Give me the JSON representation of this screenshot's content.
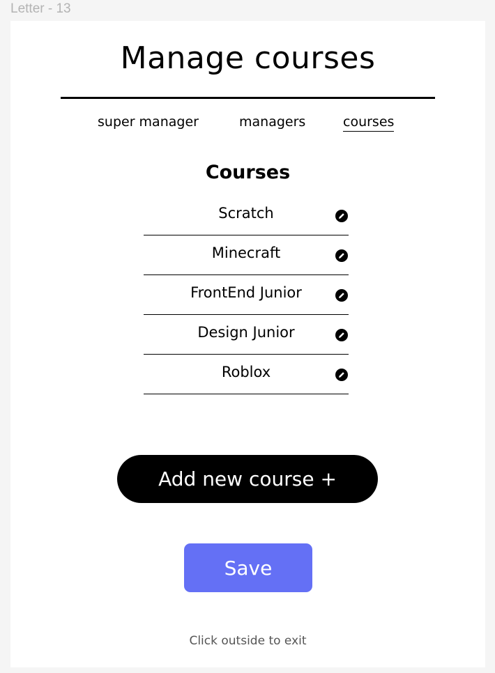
{
  "frame_label": "Letter - 13",
  "page_title": "Manage courses",
  "nav": {
    "items": [
      {
        "label": "super manager",
        "active": false
      },
      {
        "label": "managers",
        "active": false
      },
      {
        "label": "courses",
        "active": true
      }
    ]
  },
  "section_title": "Courses",
  "courses": [
    {
      "name": "Scratch",
      "icon": "pencil-icon"
    },
    {
      "name": "Minecraft",
      "icon": "pencil-icon"
    },
    {
      "name": "FrontEnd Junior",
      "icon": "pencil-icon"
    },
    {
      "name": "Design Junior",
      "icon": "pencil-icon"
    },
    {
      "name": "Roblox",
      "icon": "pencil-icon"
    }
  ],
  "add_button_label": "Add new course +",
  "save_button_label": "Save",
  "exit_hint": "Click outside to exit",
  "colors": {
    "primary_button": "#6470f5",
    "dark_button": "#000000",
    "background": "#f5f5f5",
    "card": "#ffffff"
  }
}
